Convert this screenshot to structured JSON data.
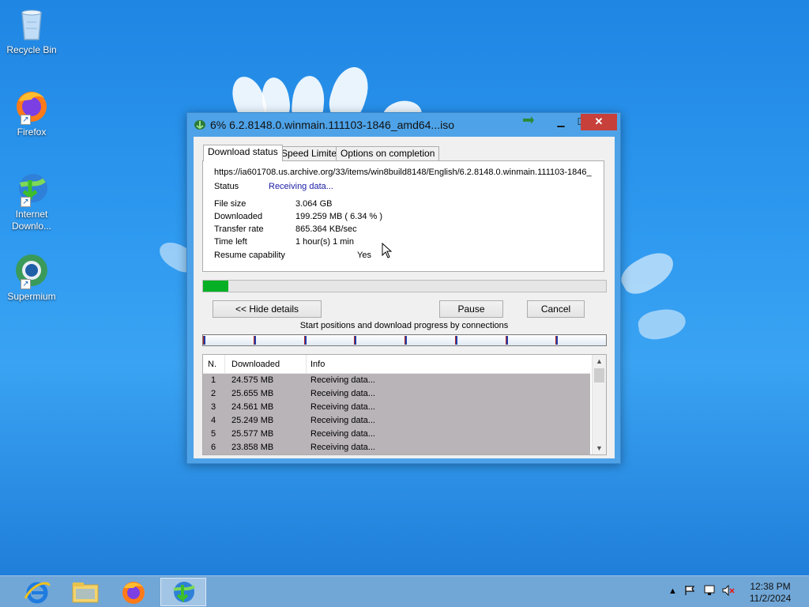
{
  "desktop": {
    "icons": [
      {
        "label": "Recycle Bin"
      },
      {
        "label": "Firefox"
      },
      {
        "label": "Internet Downlo..."
      },
      {
        "label": "Supermium"
      }
    ]
  },
  "window": {
    "title": "6% 6.2.8148.0.winmain.111103-1846_amd64...iso",
    "tabs": [
      "Download status",
      "Speed Limiter",
      "Options on completion"
    ],
    "active_tab": "Download status",
    "url": "https://ia601708.us.archive.org/33/items/win8build8148/English/6.2.8148.0.winmain.111103-1846_",
    "status_label": "Status",
    "status_value": "Receiving data...",
    "file_size_label": "File size",
    "file_size_value": "3.064  GB",
    "downloaded_label": "Downloaded",
    "downloaded_value": "199.259  MB  ( 6.34 % )",
    "transfer_rate_label": "Transfer rate",
    "transfer_rate_value": "865.364  KB/sec",
    "time_left_label": "Time left",
    "time_left_value": "1 hour(s) 1 min",
    "resume_label": "Resume capability",
    "resume_value": "Yes",
    "progress_percent": 6.34,
    "buttons": {
      "hide_details": "<< Hide details",
      "pause": "Pause",
      "cancel": "Cancel"
    },
    "connections_label": "Start positions and download progress by connections",
    "connections_count": 8,
    "list": {
      "columns": [
        "N.",
        "Downloaded",
        "Info"
      ],
      "rows": [
        {
          "n": "1",
          "downloaded": "24.575  MB",
          "info": "Receiving data..."
        },
        {
          "n": "2",
          "downloaded": "25.655  MB",
          "info": "Receiving data..."
        },
        {
          "n": "3",
          "downloaded": "24.561  MB",
          "info": "Receiving data..."
        },
        {
          "n": "4",
          "downloaded": "25.249  MB",
          "info": "Receiving data..."
        },
        {
          "n": "5",
          "downloaded": "25.577  MB",
          "info": "Receiving data..."
        },
        {
          "n": "6",
          "downloaded": "23.858  MB",
          "info": "Receiving data..."
        }
      ]
    }
  },
  "taskbar": {
    "items": [
      "internet-explorer-icon",
      "file-explorer-icon",
      "firefox-icon",
      "idm-icon"
    ],
    "active_item": "idm-icon",
    "clock": {
      "time": "12:38 PM",
      "date": "11/2/2024"
    }
  },
  "colors": {
    "progress_fill": "#06b025",
    "close_button": "#c7403a",
    "status_text": "#1a1aa6"
  }
}
